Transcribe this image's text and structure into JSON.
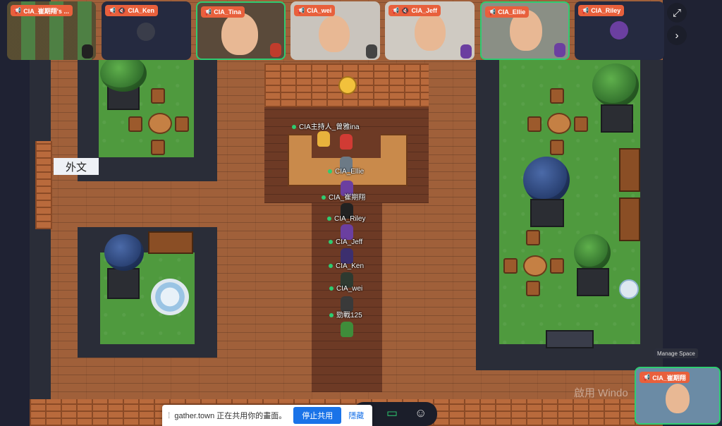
{
  "participants": [
    {
      "name": "CIA_崔期翔's ...",
      "kind": "screen"
    },
    {
      "name": "CIA_Ken",
      "kind": "avatar"
    },
    {
      "name": "CIA_Tina",
      "kind": "video"
    },
    {
      "name": "CIA_wei",
      "kind": "video"
    },
    {
      "name": "CIA_Jeff",
      "kind": "video"
    },
    {
      "name": "CIA_Ellie",
      "kind": "video"
    },
    {
      "name": "CIA_Riley",
      "kind": "avatar"
    }
  ],
  "self_tile_name": "CIA_崔期翔",
  "map": {
    "sign_label": "外文",
    "avatar_labels": [
      "CIA主持人_曾雅ina",
      "CIA_Ellie",
      "CIA_崔期翔",
      "CIA_Riley",
      "CIA_Jeff",
      "CIA_Ken",
      "CIA_wei",
      "勁戰125"
    ]
  },
  "manage_space_label": "Manage Space",
  "watermark": "啟用 Windo",
  "share_bar": {
    "text": "gather.town 正在共用你的畫面。",
    "stop_label": "停止共用",
    "hide_label": "隱藏"
  },
  "icons": [
    "megaphone-icon",
    "mic-muted-icon",
    "fullscreen-icon",
    "chevron-right-icon",
    "screen-share-icon",
    "emoji-icon",
    "grip-icon"
  ],
  "colors": {
    "accent": "#e8603c",
    "active": "#2ecc71",
    "primary": "#1a73e8"
  }
}
